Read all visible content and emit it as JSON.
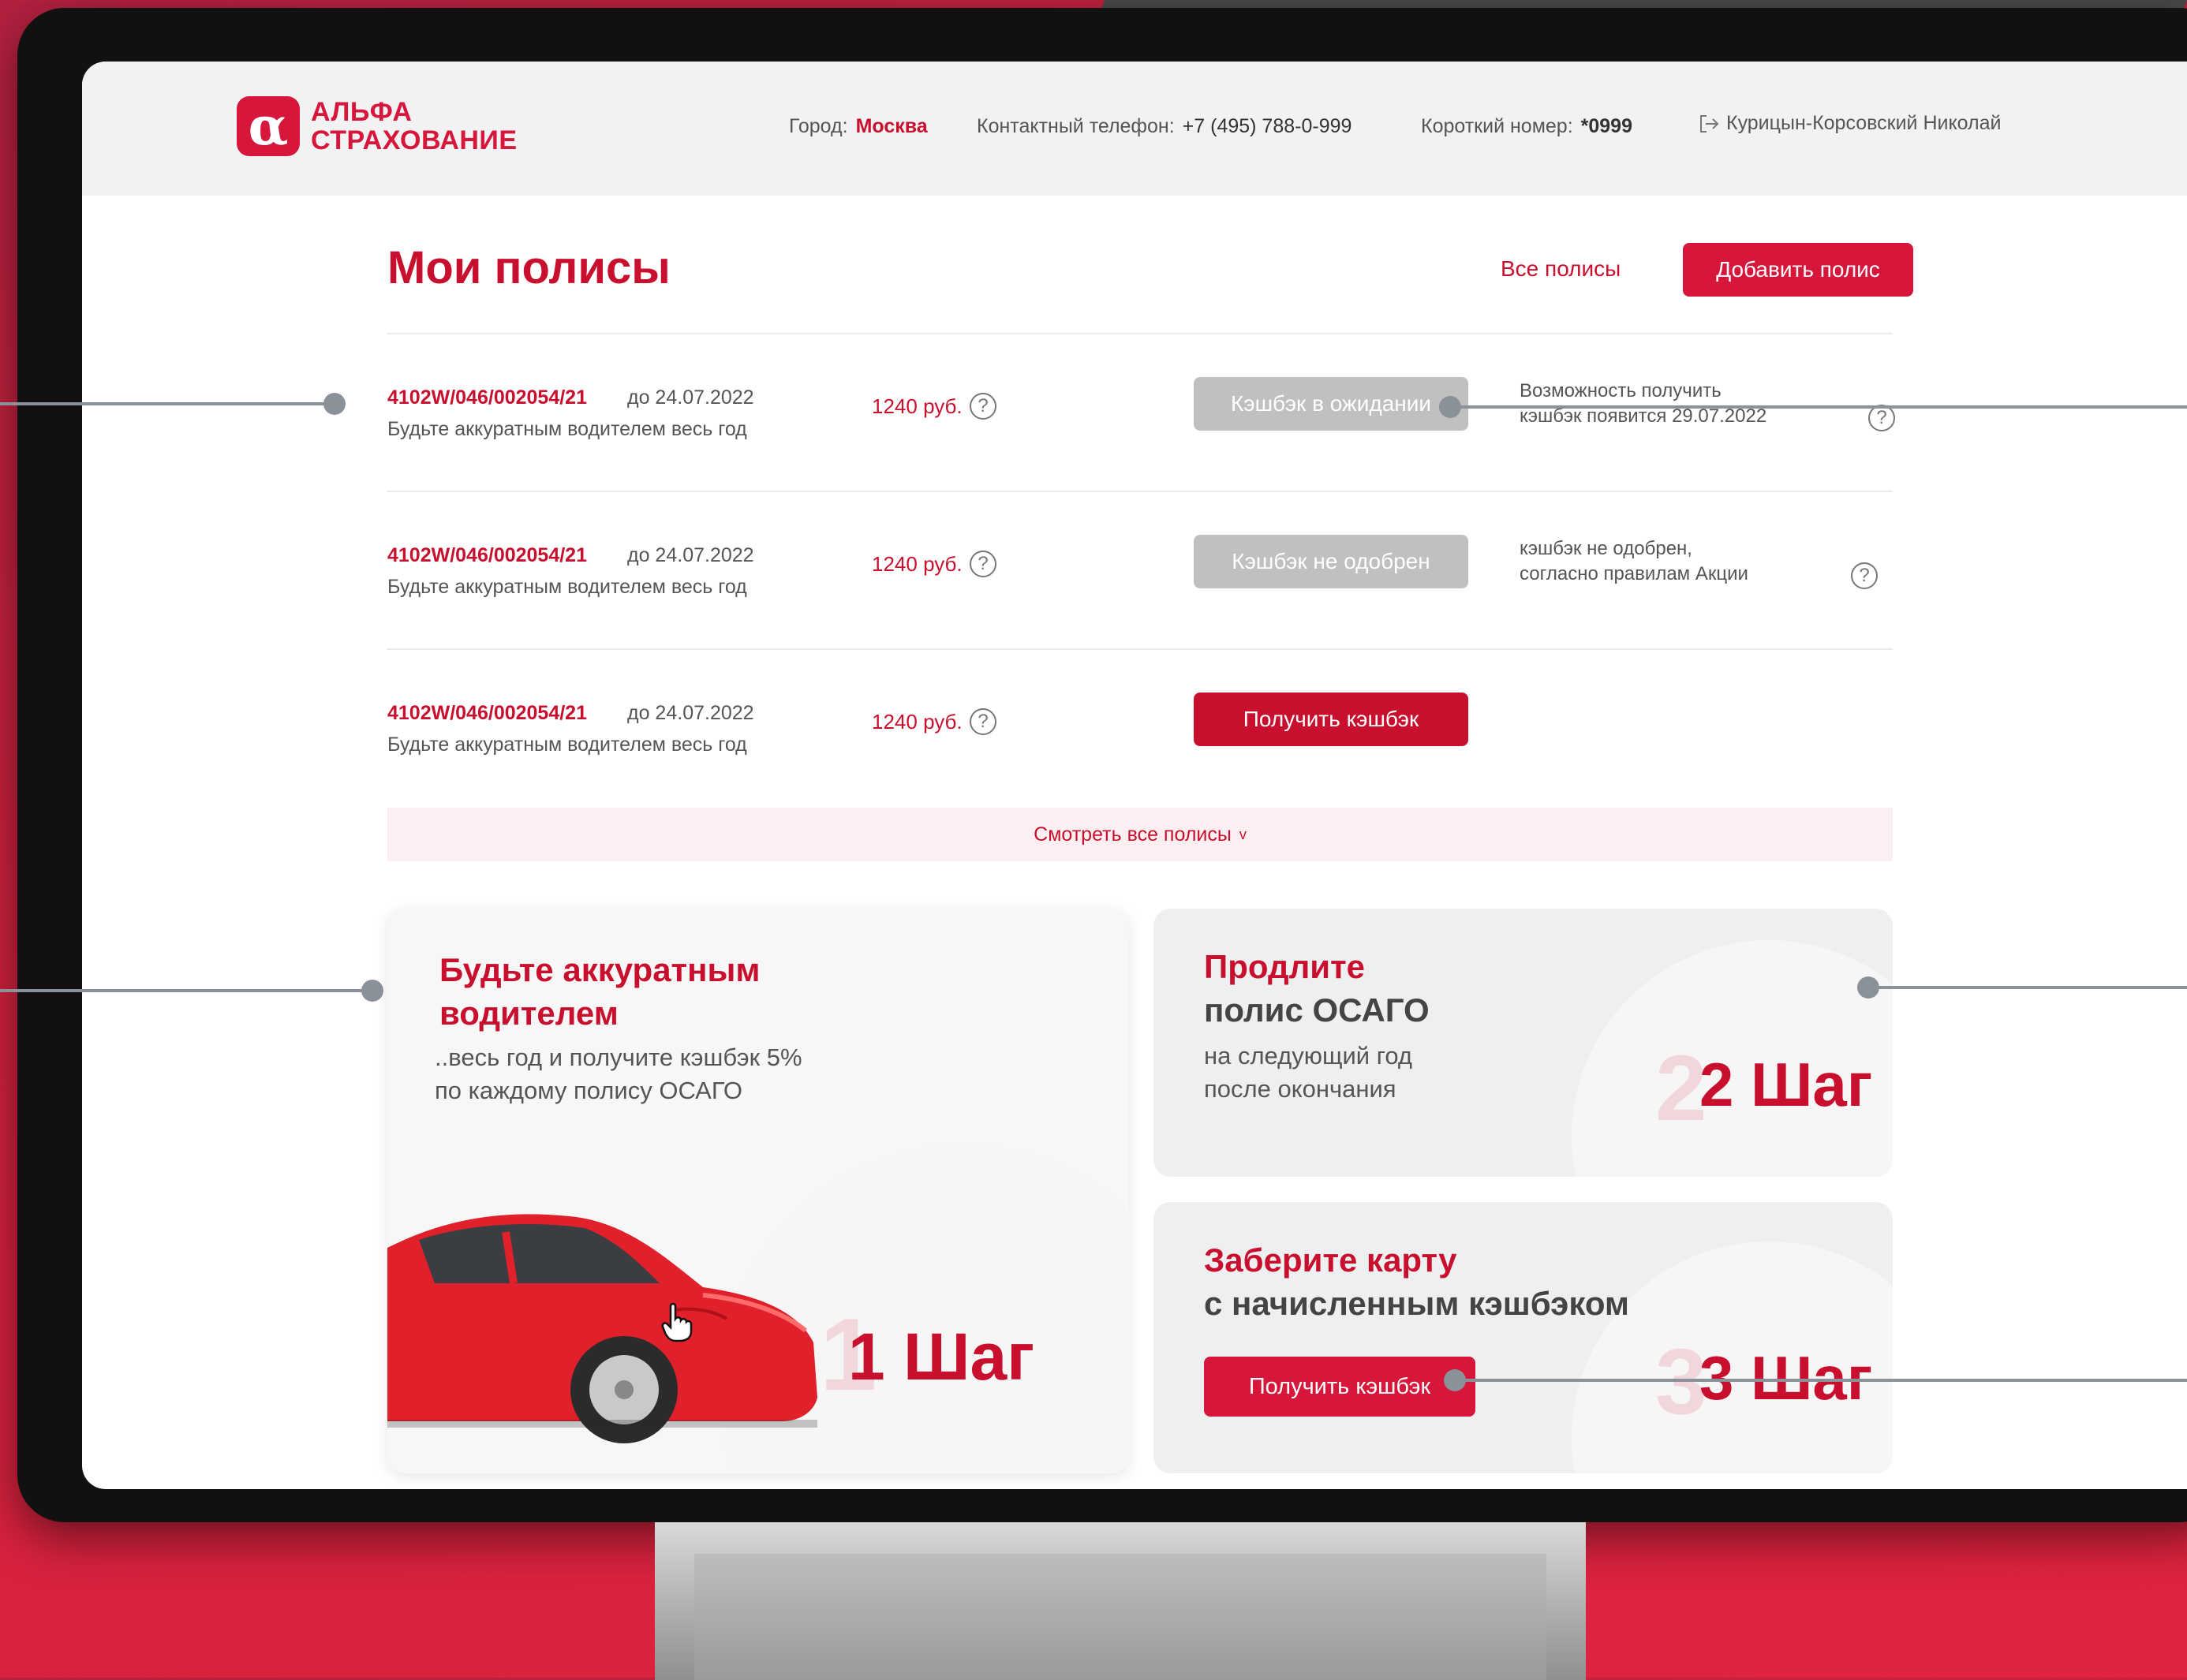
{
  "header": {
    "logo_mark": "α",
    "logo_line1": "АЛЬФА",
    "logo_line2": "СТРАХОВАНИЕ",
    "city_label": "Город:",
    "city_value": "Москва",
    "phone_label": "Контактный телефон:",
    "phone_value": "+7 (495) 788-0-999",
    "short_label": "Короткий номер:",
    "short_value": "*0999",
    "user_name": "Курицын-Корсовский Николай"
  },
  "page": {
    "title": "Мои полисы",
    "all_policies_link": "Все полисы",
    "add_policy_button": "Добавить полис",
    "see_all_label": "Смотреть все полисы",
    "see_all_chevron": "v"
  },
  "policies": [
    {
      "number": "4102W/046/002054/21",
      "date": "до 24.07.2022",
      "description": "Будьте аккуратным водителем весь год",
      "price": "1240 руб.",
      "status": "Кэшбэк в ожидании",
      "note_line1": "Возможность получить",
      "note_line2": "кэшбэк появится 29.07.2022"
    },
    {
      "number": "4102W/046/002054/21",
      "date": "до 24.07.2022",
      "description": "Будьте аккуратным водителем весь год",
      "price": "1240 руб.",
      "status": "Кэшбэк не одобрен",
      "note_line1": "кэшбэк не одобрен,",
      "note_line2": "согласно правилам Акции"
    },
    {
      "number": "4102W/046/002054/21",
      "date": "до 24.07.2022",
      "description": "Будьте аккуратным водителем весь год",
      "price": "1240 руб.",
      "status": "Получить кэшбэк"
    }
  ],
  "cards": {
    "card1": {
      "title_line1": "Будьте аккуратным",
      "title_line2": "водителем",
      "sub_line1": "..весь год и получите кэшбэк 5%",
      "sub_line2": "по каждому полису ОСАГО",
      "step_num": "1",
      "step_label": "1 Шаг"
    },
    "card2": {
      "title_line1": "Продлите",
      "title_line2": "полис ОСАГО",
      "sub_line1": "на следующий год",
      "sub_line2": "после окончания",
      "step_num": "2",
      "step_label": "2 Шаг"
    },
    "card3": {
      "title_line1": "Заберите карту",
      "title_line2": "с начисленным кэшбэком",
      "button": "Получить кэшбэк",
      "step_num": "3",
      "step_label": "3 Шаг"
    }
  },
  "help_icon_glyph": "?",
  "colors": {
    "brand_red": "#d6163a",
    "background_gradient": "#c8203e",
    "status_gray": "#c0c0c0"
  }
}
